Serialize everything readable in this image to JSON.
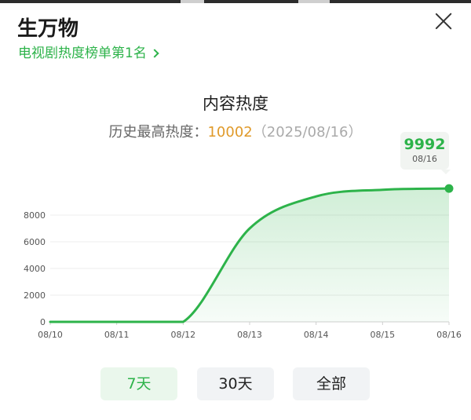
{
  "header": {
    "title": "生万物",
    "rank_link": "电视剧热度榜单第1名"
  },
  "chart_section": {
    "title": "内容热度",
    "history_label": "历史最高热度：",
    "history_max": "10002",
    "history_date": "（2025/08/16）"
  },
  "tooltip": {
    "value": "9992",
    "date": "08/16"
  },
  "tabs": [
    {
      "label": "7天",
      "active": true
    },
    {
      "label": "30天",
      "active": false
    },
    {
      "label": "全部",
      "active": false
    }
  ],
  "colors": {
    "accent": "#2db34a",
    "history_max": "#e09a2a"
  },
  "chart_data": {
    "type": "area",
    "x": [
      "08/10",
      "08/11",
      "08/12",
      "08/13",
      "08/14",
      "08/15",
      "08/16"
    ],
    "values": [
      0,
      0,
      0,
      7000,
      9400,
      9900,
      9992
    ],
    "yticks": [
      0,
      2000,
      4000,
      6000,
      8000
    ],
    "ylim": [
      0,
      10000
    ],
    "grid": true,
    "legend": "none"
  }
}
